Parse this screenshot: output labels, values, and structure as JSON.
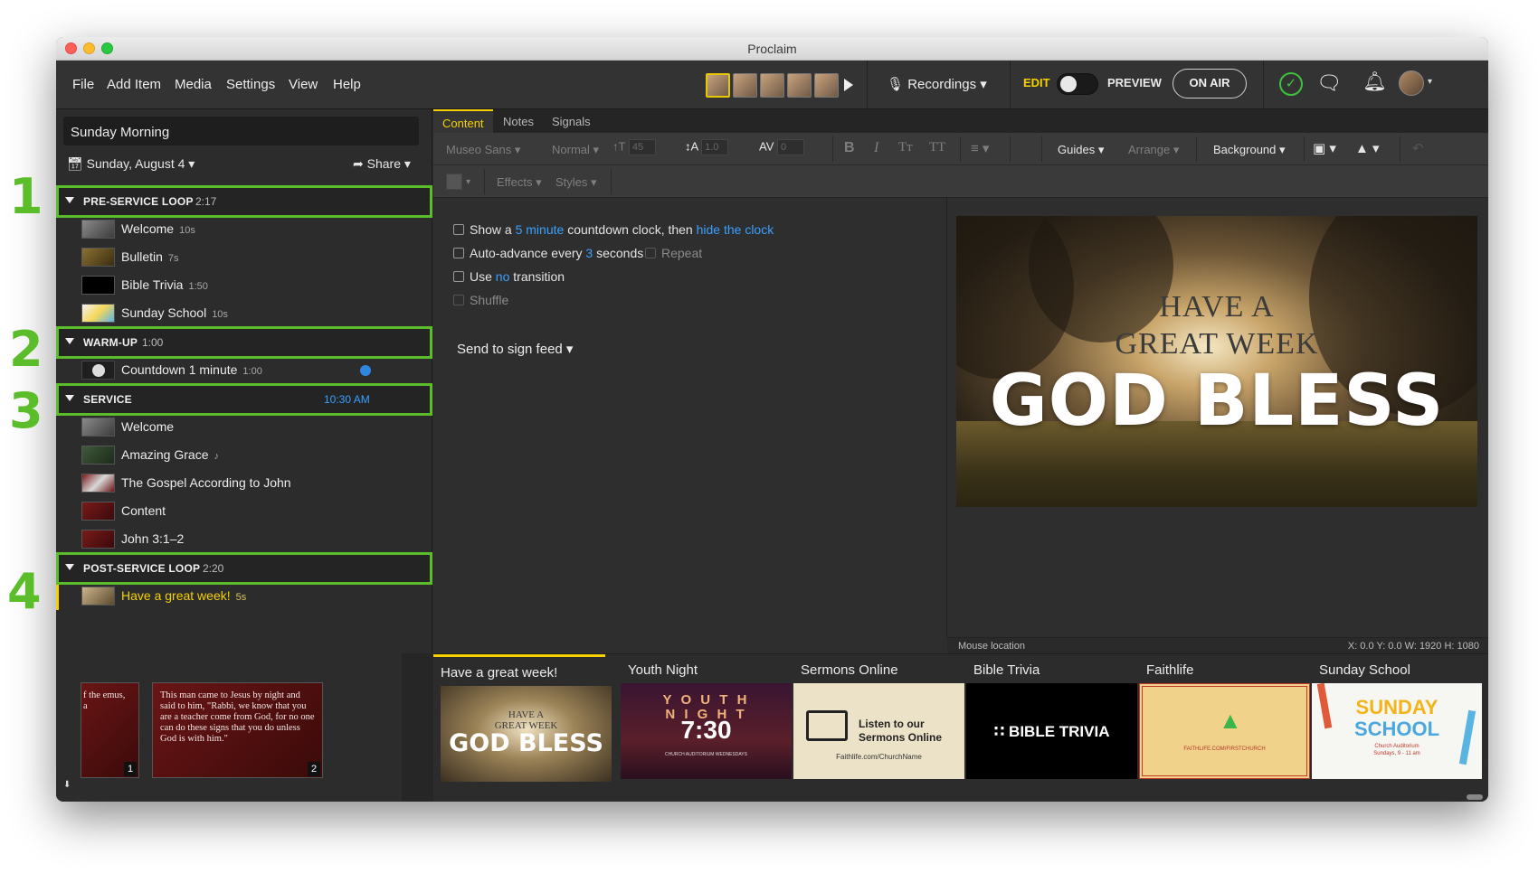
{
  "window": {
    "title": "Proclaim"
  },
  "menu": [
    "File",
    "Add Item",
    "Media",
    "Settings",
    "View",
    "Help"
  ],
  "header": {
    "recordings_label": "Recordings",
    "edit_label": "EDIT",
    "preview_label": "PREVIEW",
    "on_air_label": "ON AIR",
    "mic_icon": "microphone-icon",
    "chat_icon": "chat-icon",
    "bell_icon": "bell-icon"
  },
  "sidebar": {
    "presentation_name": "Sunday Morning",
    "date_label": "Sunday, August 4",
    "share_label": "Share",
    "sections": [
      {
        "name": "PRE-SERVICE LOOP",
        "time": "2:17",
        "number": "1",
        "items": [
          {
            "label": "Welcome",
            "duration": "10s"
          },
          {
            "label": "Bulletin",
            "duration": "7s"
          },
          {
            "label": "Bible Trivia",
            "duration": "1:50"
          },
          {
            "label": "Sunday School",
            "duration": "10s"
          }
        ]
      },
      {
        "name": "WARM-UP",
        "time": "1:00",
        "number": "2",
        "items": [
          {
            "label": "Countdown 1 minute",
            "duration": "1:00"
          }
        ]
      },
      {
        "name": "SERVICE",
        "time": "10:30 AM",
        "number": "3",
        "items": [
          {
            "label": "Welcome",
            "duration": ""
          },
          {
            "label": "Amazing Grace",
            "duration": "♪"
          },
          {
            "label": "The Gospel According to John",
            "duration": ""
          },
          {
            "label": "Content",
            "duration": ""
          },
          {
            "label": "John 3:1–2",
            "duration": ""
          }
        ]
      },
      {
        "name": "POST-SERVICE LOOP",
        "time": "2:20",
        "number": "4",
        "items": [
          {
            "label": "Have a great week!",
            "duration": "5s"
          }
        ]
      }
    ]
  },
  "editor": {
    "tabs": [
      "Content",
      "Notes",
      "Signals"
    ],
    "toolbar": {
      "font": "Museo Sans",
      "weight": "Normal",
      "size": "45",
      "line_height": "1.0",
      "spacing": "0",
      "guides": "Guides",
      "arrange": "Arrange",
      "background": "Background",
      "effects": "Effects",
      "styles": "Styles"
    },
    "options": {
      "countdown_pre": "Show a",
      "countdown_link": "5 minute",
      "countdown_mid": "countdown clock, then",
      "countdown_end": "hide the clock",
      "autoadvance_pre": "Auto-advance every",
      "autoadvance_num": "3",
      "autoadvance_post": "seconds",
      "repeat": "Repeat",
      "transition_pre": "Use",
      "transition_link": "no",
      "transition_post": "transition",
      "shuffle": "Shuffle",
      "send_sign_feed": "Send to sign feed"
    },
    "slide": {
      "line1": "HAVE A",
      "line2": "GREAT WEEK",
      "line3": "GOD BLESS"
    },
    "status": {
      "mouse_location": "Mouse location",
      "coords": "X: 0.0  Y: 0.0    W: 1920  H: 1080"
    }
  },
  "filmstrip": {
    "verse_slides": [
      {
        "text": "f the\nemus, a",
        "number": "1"
      },
      {
        "text": "This man came to Jesus by night and said to him, \"Rabbi, we know that you are a teacher come from God, for no one can do these signs that you do unless God is with him.\"",
        "number": "2"
      }
    ],
    "cards": [
      {
        "title": "Have a great week!",
        "t1": "HAVE A",
        "t2": "GREAT WEEK",
        "t3": "GOD BLESS"
      },
      {
        "title": "Youth Night",
        "t1": "Y O U T H",
        "t2": "N I G H T",
        "t3": "7:30",
        "t4": "CHURCH AUDITORIUM WEDNESDAYS"
      },
      {
        "title": "Sermons Online",
        "t1": "Listen to our",
        "t2": "Sermons Online",
        "t3": "Faithlife.com/ChurchName"
      },
      {
        "title": "Bible Trivia",
        "t1": "BIBLE TRIVIA"
      },
      {
        "title": "Faithlife",
        "t1": "FAITHLIFE.COM/FIRSTCHURCH"
      },
      {
        "title": "Sunday School",
        "t1": "SUNDAY",
        "t2": "SCHOOL",
        "t3": "Church Auditorium",
        "t4": "Sundays, 9 - 11 am"
      }
    ]
  },
  "colors": {
    "accent": "#f5d100",
    "link": "#3aa0ff",
    "annotation": "#5cbd2a"
  }
}
